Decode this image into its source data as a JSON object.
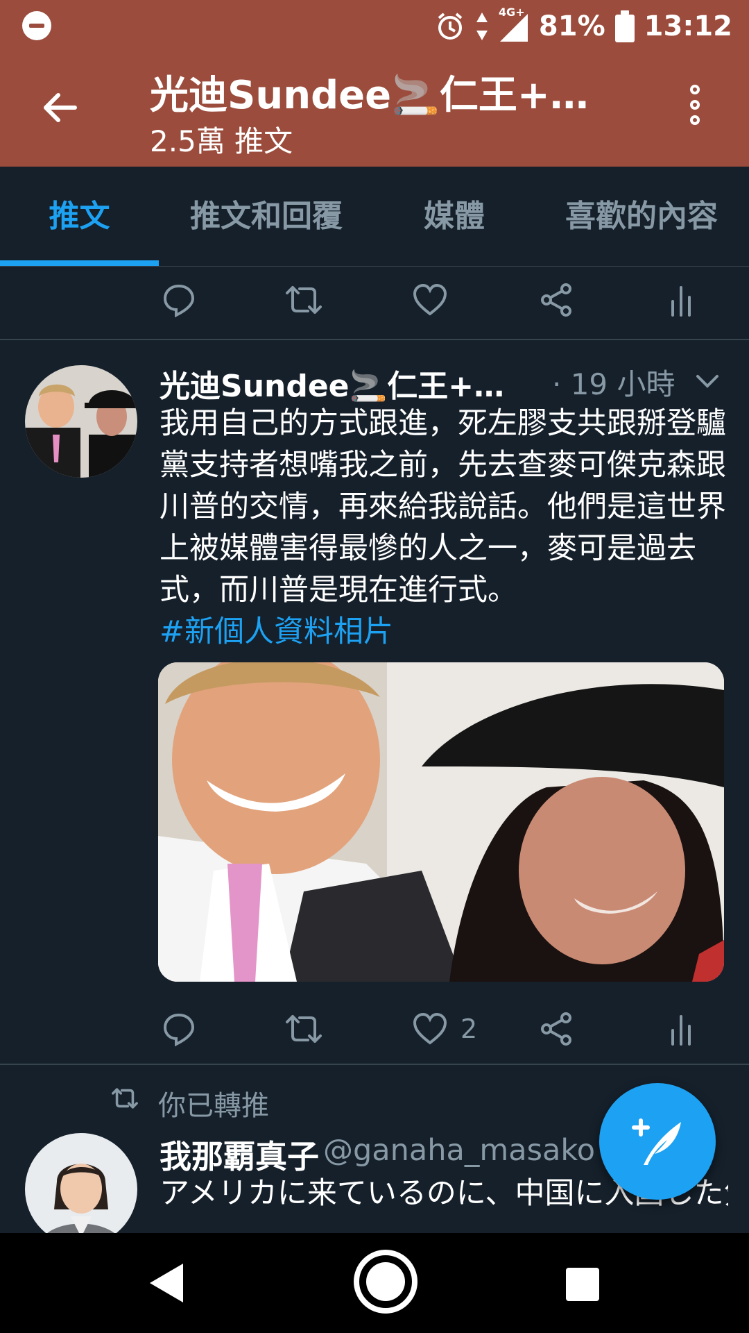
{
  "status_bar": {
    "network": "4G+",
    "battery": "81%",
    "time": "13:12"
  },
  "header": {
    "title": "光迪Sundee🚬仁王+惡...",
    "subtitle": "2.5萬 推文"
  },
  "tabs": [
    {
      "label": "推文",
      "active": true
    },
    {
      "label": "推文和回覆",
      "active": false
    },
    {
      "label": "媒體",
      "active": false
    },
    {
      "label": "喜歡的內容",
      "active": false
    }
  ],
  "tweet1": {
    "author": "光迪Sundee🚬仁王+惡魔...",
    "time": "· 19 小時",
    "text": "我用自己的方式跟進，死左膠支共跟掰登驢黨支持者想嘴我之前，先去查麥可傑克森跟川普的交情，再來給我說話。他們是這世界上被媒體害得最慘的人之一，麥可是過去式，而川普是現在進行式。",
    "hashtag": "#新個人資料相片",
    "like_count": "2"
  },
  "retweet_label": "你已轉推",
  "tweet2": {
    "author": "我那覇真子",
    "handle": "@ganaha_masako ·",
    "text": "アメリカに来ているのに、中国に入国した気分です。"
  },
  "colors": {
    "header_bg": "#9b4c3c",
    "page_bg": "#15202b",
    "accent": "#1da1f2",
    "muted": "#8899a6"
  }
}
